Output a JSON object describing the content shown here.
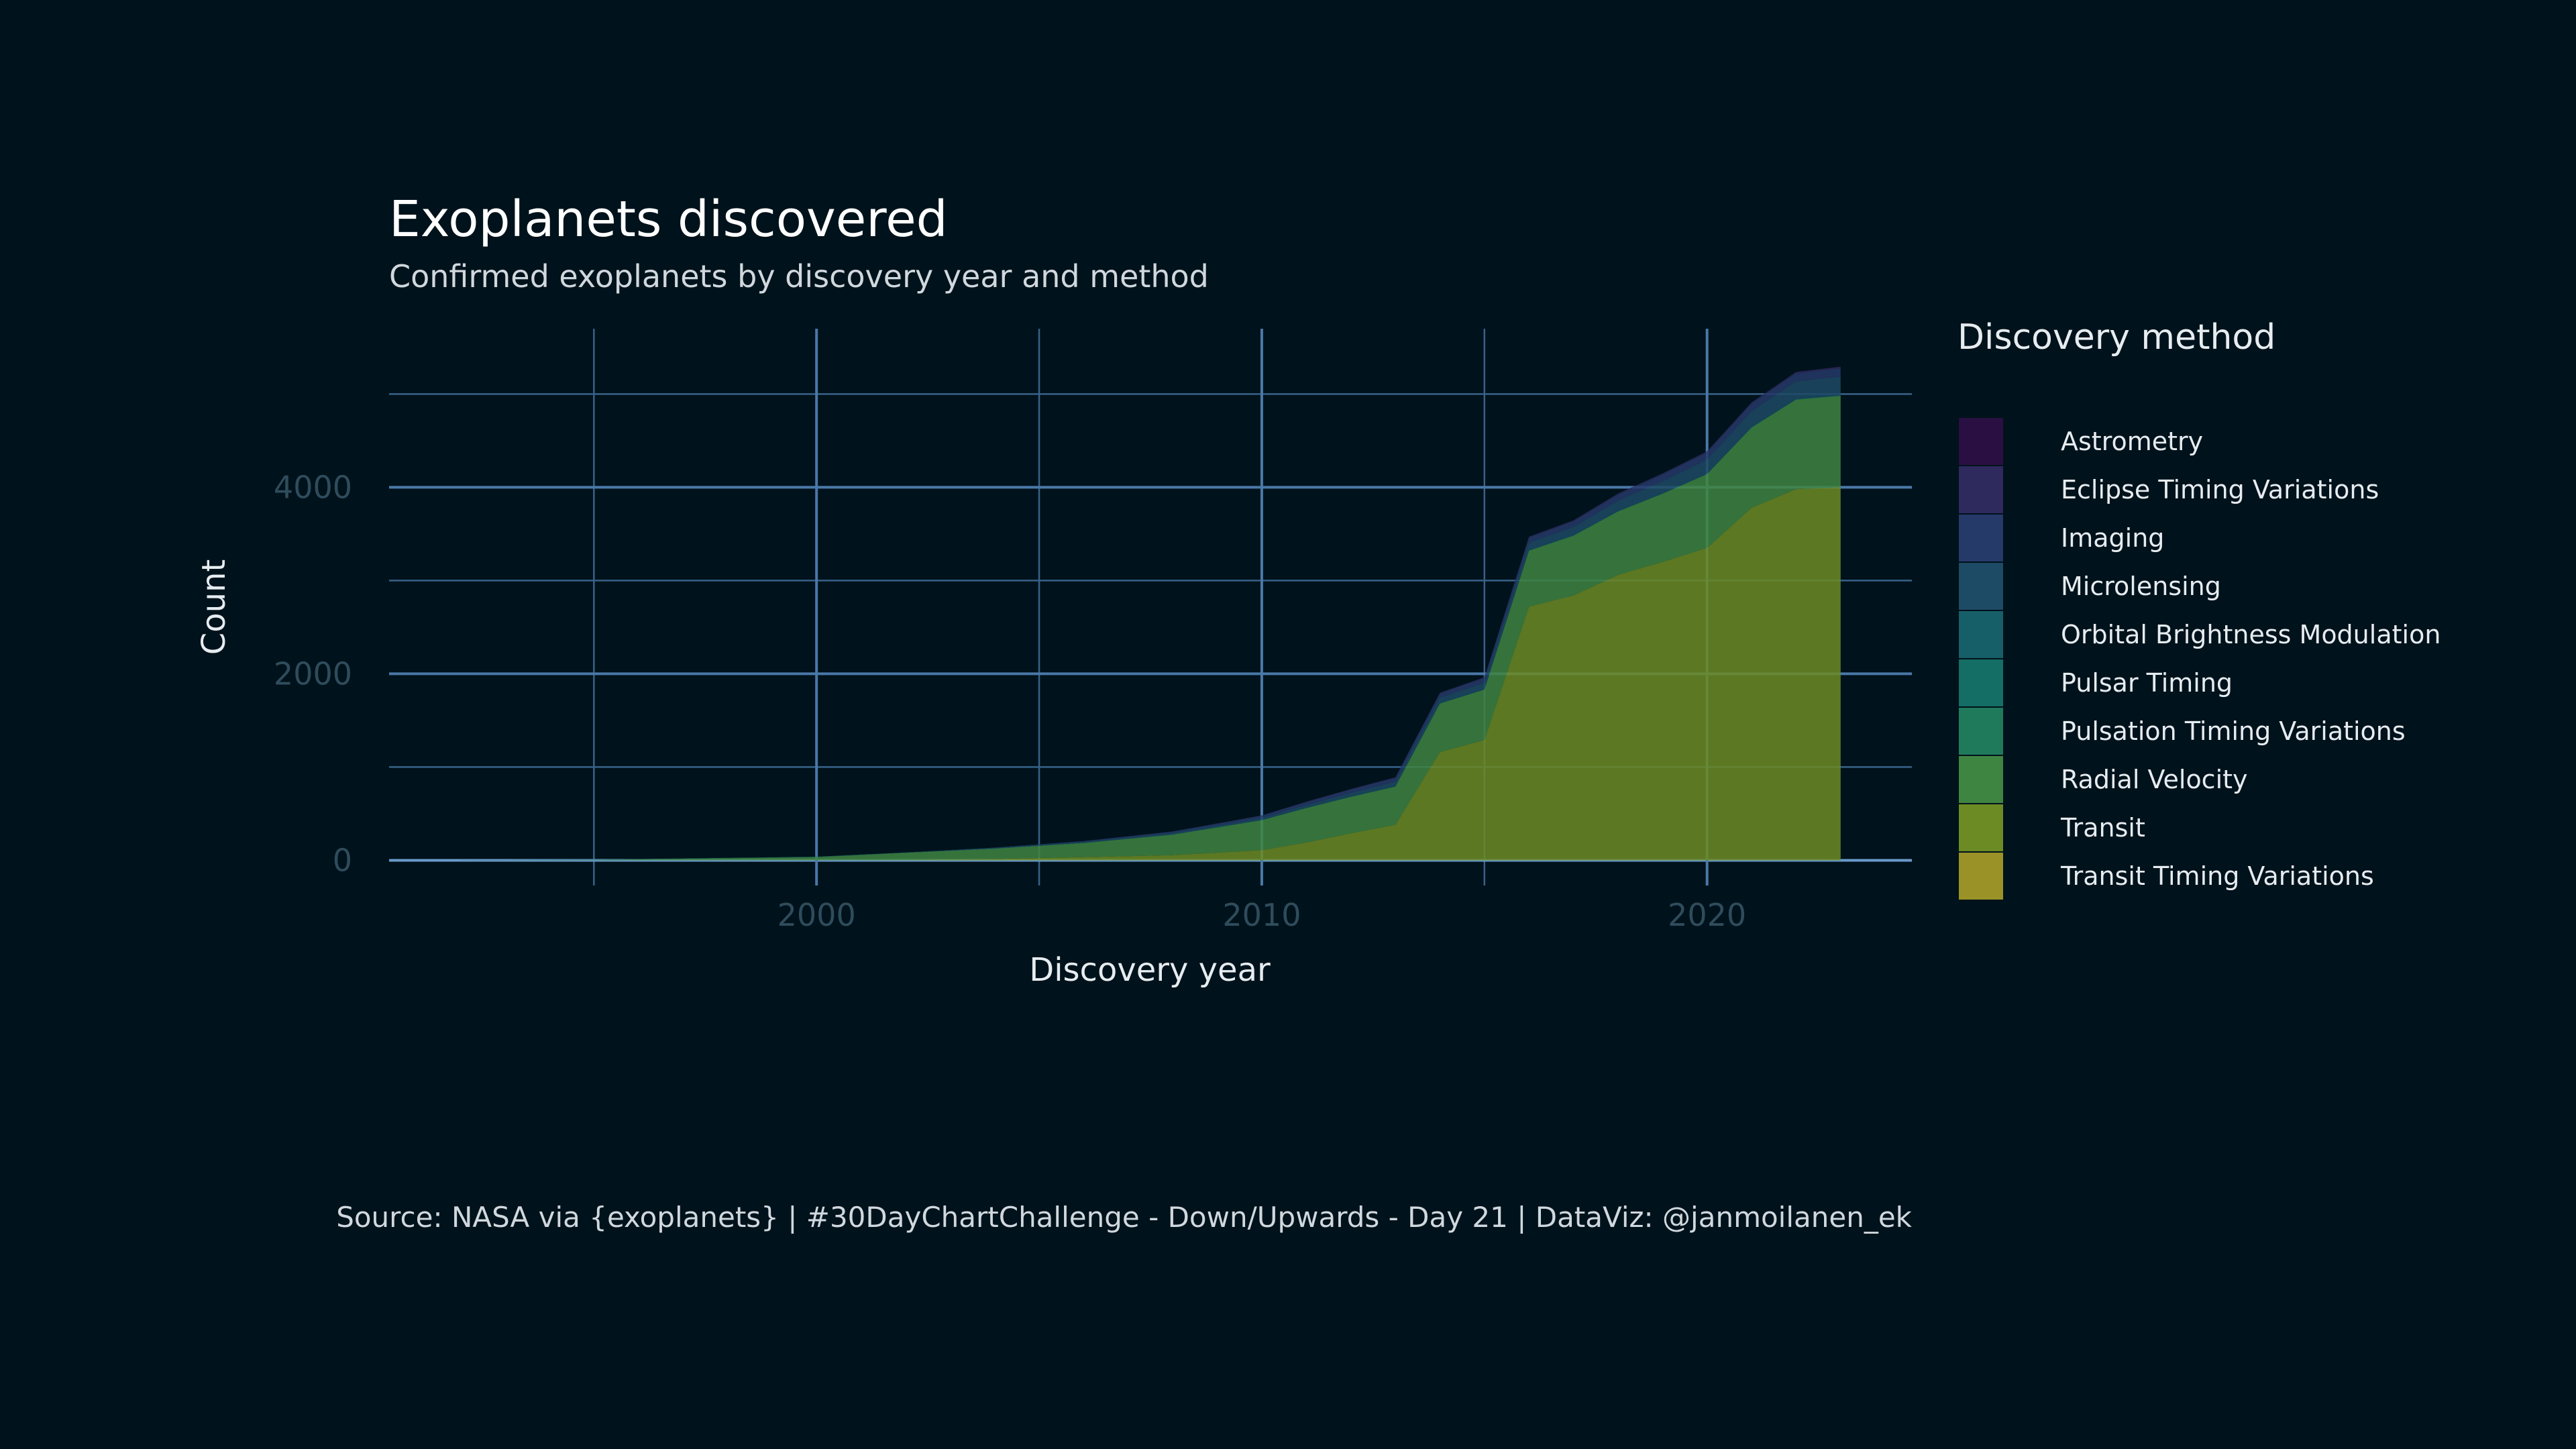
{
  "chart_data": {
    "type": "area",
    "stacked": true,
    "title": "Exoplanets discovered",
    "subtitle": "Confirmed exoplanets by discovery year and method",
    "xlabel": "Discovery year",
    "ylabel": "Count",
    "xlim": [
      1990.4,
      2024.6
    ],
    "ylim": [
      -270,
      5700
    ],
    "xticks": [
      2000,
      2010,
      2020
    ],
    "yticks": [
      0,
      2000,
      4000
    ],
    "xminor": [
      1995,
      2005,
      2015
    ],
    "yminor": [
      1000,
      3000,
      5000
    ],
    "grid": true,
    "legend_title": "Discovery method",
    "legend_position": "right",
    "caption": "Source: NASA via {exoplanets} | #30DayChartChallenge - Down/Upwards - Day 21 | DataViz: @janmoilanen_ek",
    "x": [
      1992,
      1995,
      2000,
      2002,
      2004,
      2006,
      2008,
      2010,
      2011,
      2012,
      2013,
      2014,
      2015,
      2016,
      2017,
      2018,
      2019,
      2020,
      2021,
      2022,
      2023
    ],
    "series": [
      {
        "name": "Transit Timing Variations",
        "color": "#9a9226",
        "values": [
          0,
          0,
          0,
          0,
          0,
          0,
          0,
          0,
          0,
          0,
          0,
          0,
          0,
          0,
          0,
          0,
          0,
          0,
          0,
          0,
          0
        ]
      },
      {
        "name": "Transit",
        "color": "#6c8b24",
        "values": [
          0,
          0,
          0,
          5,
          15,
          35,
          55,
          110,
          190,
          290,
          380,
          1160,
          1290,
          2720,
          2840,
          3060,
          3200,
          3350,
          3780,
          3980,
          4000
        ]
      },
      {
        "name": "Radial Velocity",
        "color": "#3f8542",
        "values": [
          0,
          5,
          35,
          75,
          110,
          150,
          220,
          320,
          370,
          390,
          410,
          520,
          540,
          600,
          640,
          680,
          730,
          790,
          860,
          960,
          980
        ]
      },
      {
        "name": "Pulsation Timing Variations",
        "color": "#1f7a5c",
        "values": [
          0,
          0,
          0,
          0,
          0,
          0,
          0,
          0,
          0,
          0,
          0,
          0,
          0,
          0,
          0,
          0,
          0,
          0,
          0,
          0,
          0
        ]
      },
      {
        "name": "Pulsar Timing",
        "color": "#146e66",
        "values": [
          2,
          3,
          4,
          4,
          4,
          4,
          4,
          4,
          4,
          4,
          4,
          4,
          4,
          5,
          5,
          5,
          5,
          6,
          6,
          6,
          6
        ]
      },
      {
        "name": "Orbital Brightness Modulation",
        "color": "#175f68",
        "values": [
          0,
          0,
          0,
          0,
          0,
          0,
          0,
          0,
          0,
          0,
          0,
          0,
          0,
          0,
          0,
          0,
          0,
          0,
          0,
          0,
          0
        ]
      },
      {
        "name": "Microlensing",
        "color": "#1d4a64",
        "values": [
          0,
          0,
          0,
          0,
          5,
          10,
          15,
          20,
          30,
          40,
          50,
          60,
          70,
          80,
          90,
          110,
          130,
          150,
          170,
          190,
          200
        ]
      },
      {
        "name": "Imaging",
        "color": "#253a68",
        "values": [
          0,
          0,
          0,
          1,
          3,
          8,
          15,
          25,
          30,
          35,
          40,
          45,
          50,
          55,
          60,
          65,
          70,
          75,
          80,
          85,
          90
        ]
      },
      {
        "name": "Eclipse Timing Variations",
        "color": "#2e2a5e",
        "values": [
          0,
          0,
          0,
          0,
          0,
          0,
          1,
          3,
          5,
          6,
          7,
          8,
          9,
          10,
          11,
          12,
          13,
          14,
          15,
          16,
          17
        ]
      },
      {
        "name": "Astrometry",
        "color": "#2a0f42",
        "values": [
          0,
          0,
          0,
          0,
          0,
          0,
          0,
          0,
          0,
          0,
          0,
          0,
          0,
          0,
          0,
          0,
          0,
          0,
          0,
          0,
          1
        ]
      }
    ],
    "legend_order": [
      "Astrometry",
      "Eclipse Timing Variations",
      "Imaging",
      "Microlensing",
      "Orbital Brightness Modulation",
      "Pulsar Timing",
      "Pulsation Timing Variations",
      "Radial Velocity",
      "Transit",
      "Transit Timing Variations"
    ]
  },
  "colors": {
    "background": "#00121b",
    "grid_major": "#4a78a8",
    "grid_minor": "#38628a",
    "zero_line": "#6a9acb"
  }
}
